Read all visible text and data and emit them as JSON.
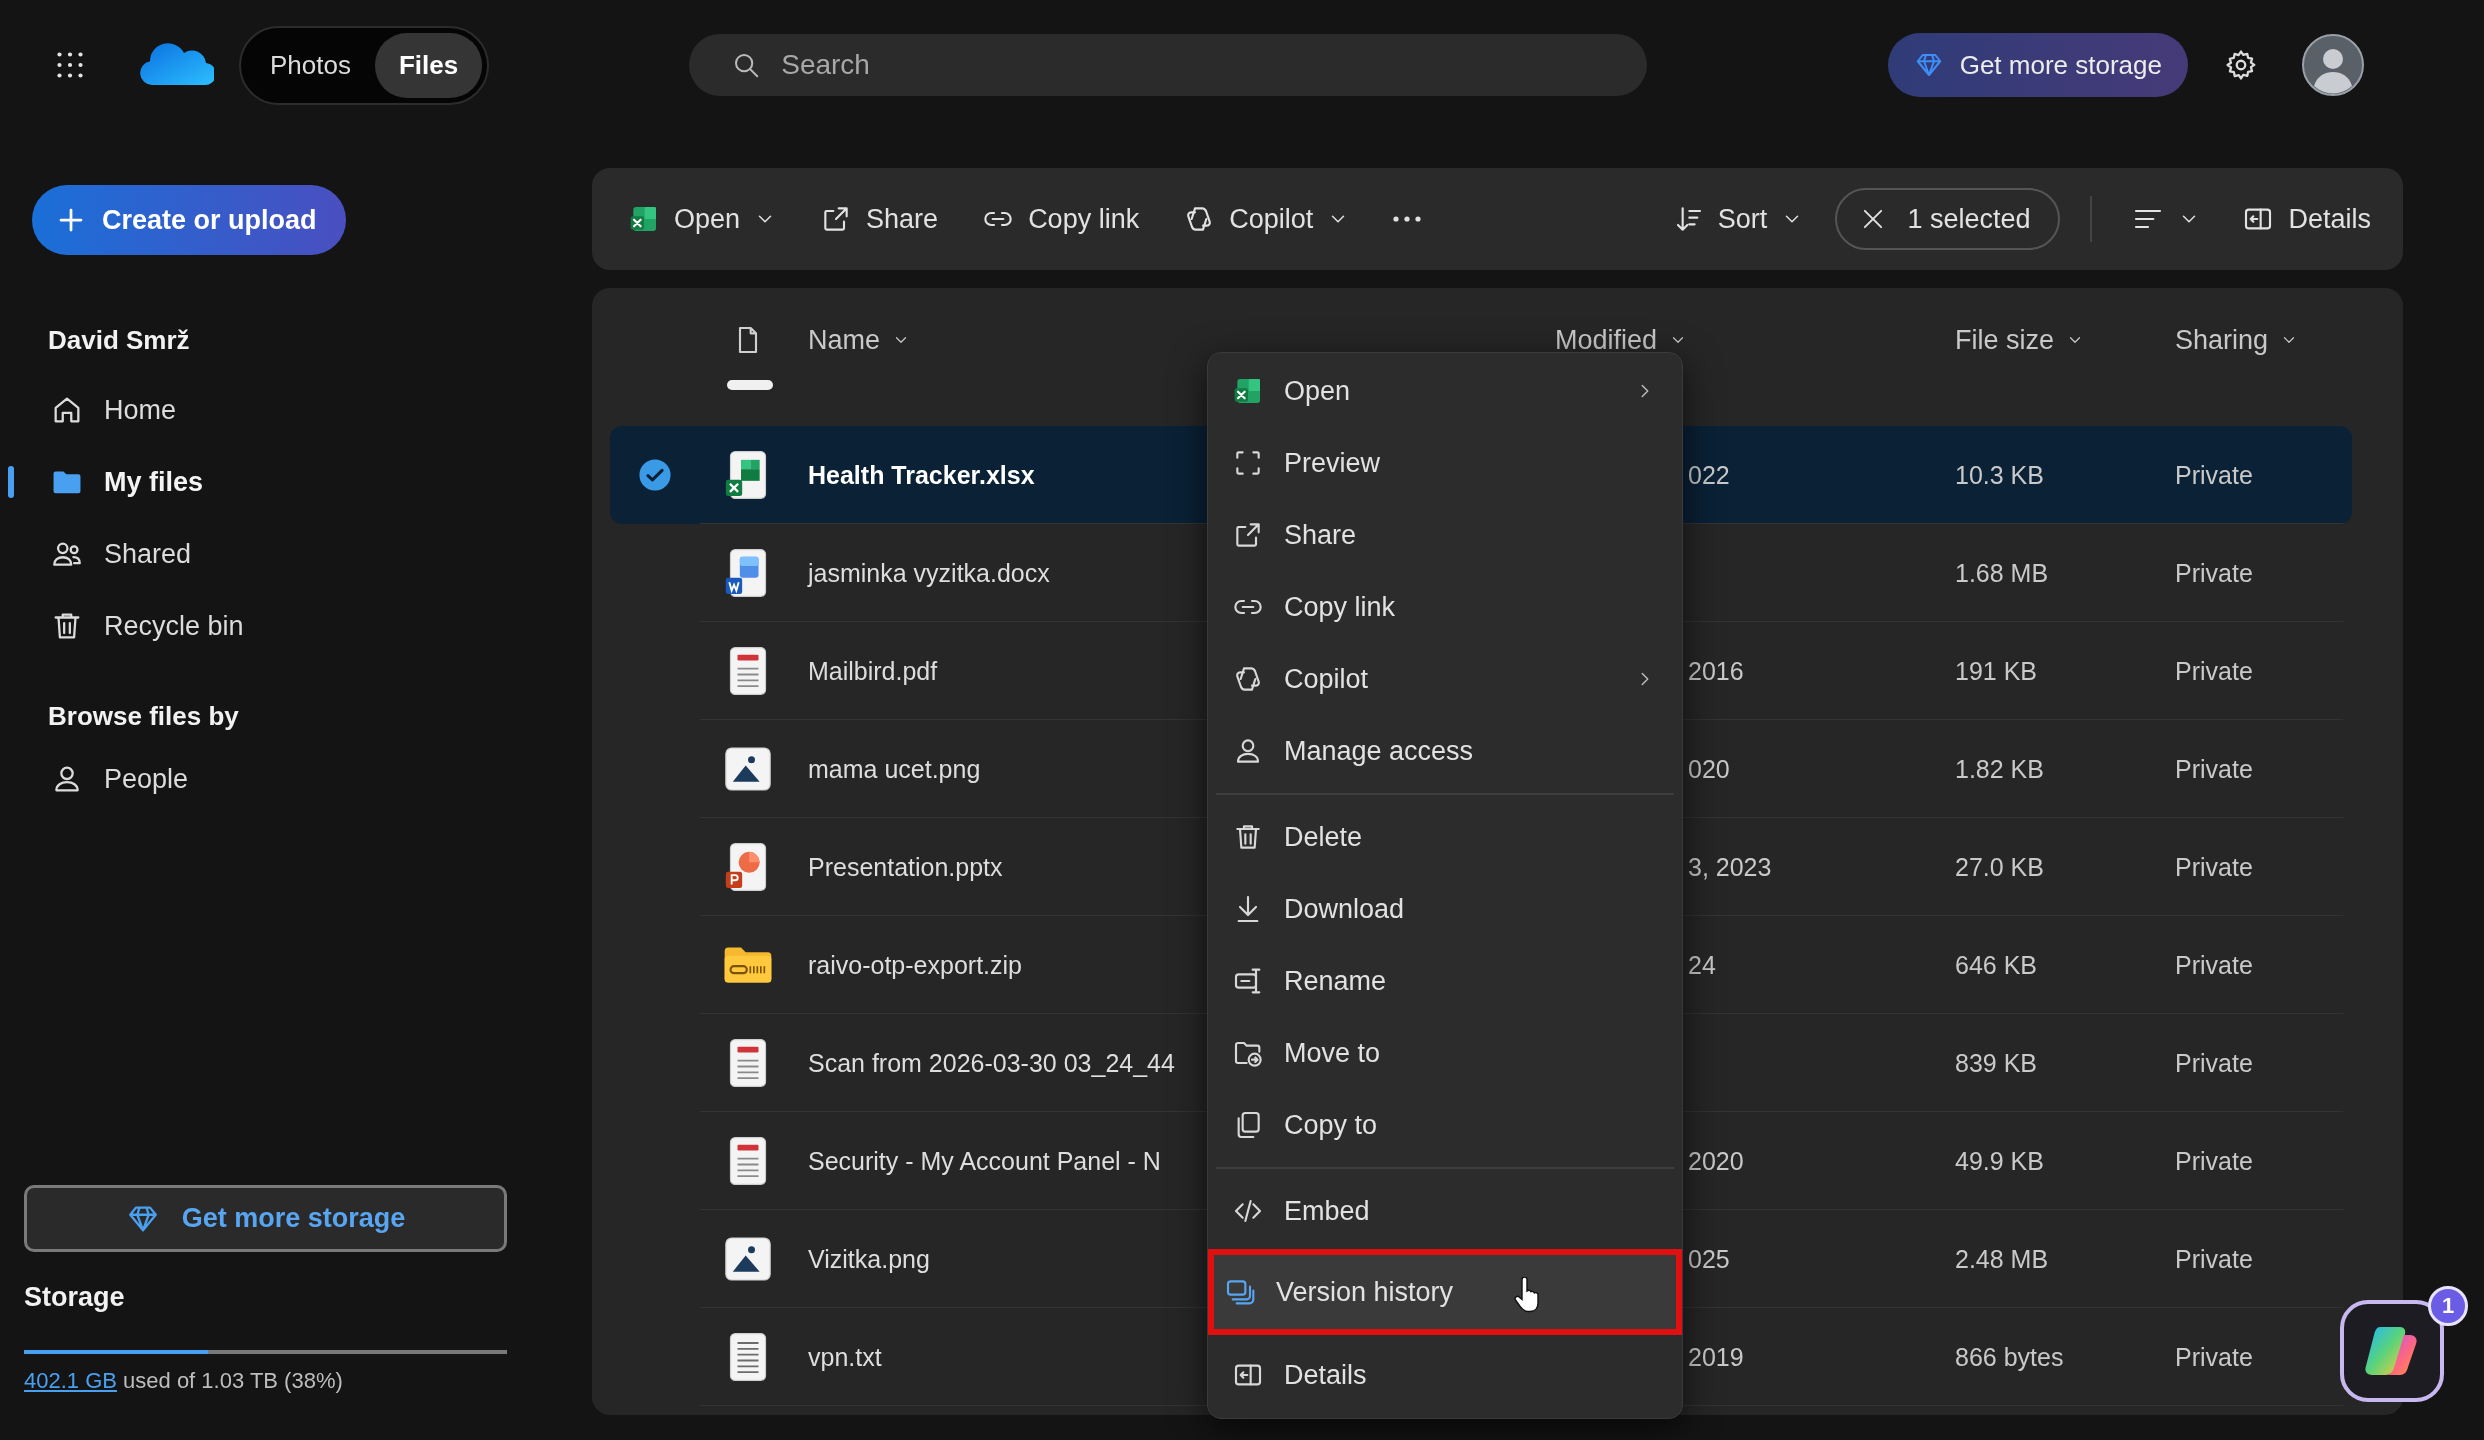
{
  "topbar": {
    "tabs": [
      {
        "label": "Photos",
        "selected": false
      },
      {
        "label": "Files",
        "selected": true
      }
    ],
    "search": {
      "placeholder": "Search"
    },
    "storage_button": "Get more storage"
  },
  "sidebar": {
    "create_button": "Create or upload",
    "account": "David Smrž",
    "nav": [
      {
        "label": "Home",
        "selected": false
      },
      {
        "label": "My files",
        "selected": true
      },
      {
        "label": "Shared",
        "selected": false
      },
      {
        "label": "Recycle bin",
        "selected": false
      }
    ],
    "browse_heading": "Browse files by",
    "browse": [
      {
        "label": "People",
        "selected": false
      }
    ],
    "storage_button": "Get more storage",
    "storage": {
      "title": "Storage",
      "used": "402.1 GB",
      "rest": "used of 1.03 TB (38%)",
      "level": 0.38
    }
  },
  "toolbar": {
    "actions": [
      {
        "label": "Open",
        "dropdown": true
      },
      {
        "label": "Share",
        "dropdown": false
      },
      {
        "label": "Copy link",
        "dropdown": false
      },
      {
        "label": "Copilot",
        "dropdown": true
      }
    ],
    "sort": {
      "label": "Sort",
      "dropdown": true
    },
    "selection": {
      "label": "1 selected"
    },
    "details": {
      "label": "Details"
    }
  },
  "file_list": {
    "columns": [
      {
        "label": "Name"
      },
      {
        "label": "Modified"
      },
      {
        "label": "File size"
      },
      {
        "label": "Sharing"
      }
    ],
    "rows": [
      {
        "name": "Health Tracker.xlsx",
        "kind": "spreadsheet",
        "modified": "022",
        "size": "10.3 KB",
        "sharing": "Private",
        "selected": true
      },
      {
        "name": "jasminka vyzitka.docx",
        "kind": "document",
        "size": "1.68 MB",
        "sharing": "Private",
        "selected": false
      },
      {
        "name": "Mailbird.pdf",
        "kind": "pdf",
        "modified": "2016",
        "size": "191 KB",
        "sharing": "Private",
        "selected": false
      },
      {
        "name": "mama ucet.png",
        "kind": "image",
        "modified": "020",
        "size": "1.82 KB",
        "sharing": "Private",
        "selected": false
      },
      {
        "name": "Presentation.pptx",
        "kind": "presentation",
        "modified": "3, 2023",
        "size": "27.0 KB",
        "sharing": "Private",
        "selected": false
      },
      {
        "name": "raivo-otp-export.zip",
        "kind": "archive",
        "modified": "24",
        "size": "646 KB",
        "sharing": "Private",
        "selected": false
      },
      {
        "name": "Scan from 2026-03-30 03_24_44",
        "kind": "pdf",
        "size": "839 KB",
        "sharing": "Private",
        "selected": false
      },
      {
        "name": "Security - My Account Panel - N",
        "kind": "pdf",
        "modified": "2020",
        "size": "49.9 KB",
        "sharing": "Private",
        "selected": false
      },
      {
        "name": "Vizitka.png",
        "kind": "image",
        "modified": "025",
        "size": "2.48 MB",
        "sharing": "Private",
        "selected": false
      },
      {
        "name": "vpn.txt",
        "kind": "text",
        "modified": "2019",
        "size": "866 bytes",
        "sharing": "Private",
        "selected": false
      }
    ]
  },
  "context_menu": {
    "groups": [
      [
        {
          "label": "Open",
          "submenu": true,
          "hovered": false,
          "outlined": false
        },
        {
          "label": "Preview",
          "submenu": false,
          "hovered": false,
          "outlined": false
        },
        {
          "label": "Share",
          "submenu": false,
          "hovered": false,
          "outlined": false
        },
        {
          "label": "Copy link",
          "submenu": false,
          "hovered": false,
          "outlined": false
        },
        {
          "label": "Copilot",
          "submenu": true,
          "hovered": false,
          "outlined": false
        },
        {
          "label": "Manage access",
          "submenu": false,
          "hovered": false,
          "outlined": false
        }
      ],
      [
        {
          "label": "Delete",
          "submenu": false,
          "hovered": false,
          "outlined": false
        },
        {
          "label": "Download",
          "submenu": false,
          "hovered": false,
          "outlined": false
        },
        {
          "label": "Rename",
          "submenu": false,
          "hovered": false,
          "outlined": false
        },
        {
          "label": "Move to",
          "submenu": false,
          "hovered": false,
          "outlined": false
        },
        {
          "label": "Copy to",
          "submenu": false,
          "hovered": false,
          "outlined": false
        }
      ],
      [
        {
          "label": "Embed",
          "submenu": false,
          "hovered": false,
          "outlined": false
        },
        {
          "label": "Version history",
          "submenu": false,
          "hovered": true,
          "outlined": true
        },
        {
          "label": "Details",
          "submenu": false,
          "hovered": false,
          "outlined": false
        }
      ]
    ]
  },
  "copilot_button": {
    "badge": "1"
  }
}
